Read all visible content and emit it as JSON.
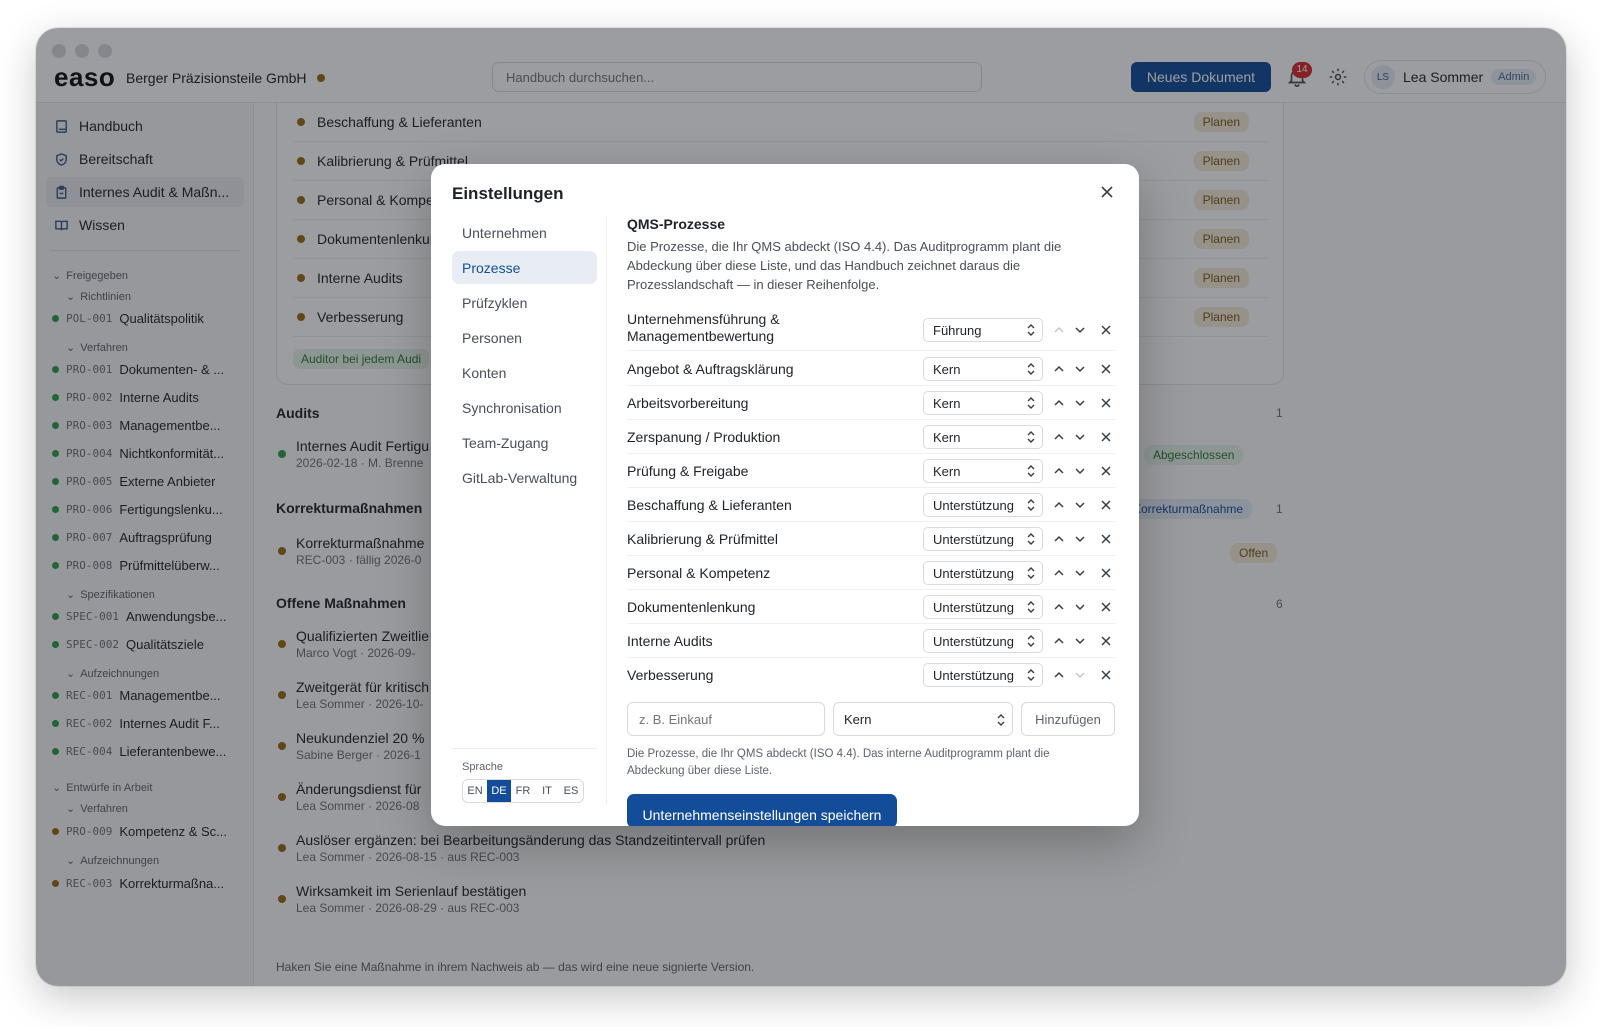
{
  "app": {
    "logo": "easo",
    "company": "Berger Präzisionsteile GmbH",
    "search_placeholder": "Handbuch durchsuchen...",
    "new_doc_label": "Neues Dokument",
    "notifications_count": "14",
    "user": {
      "initials": "LS",
      "name": "Lea Sommer",
      "role": "Admin"
    }
  },
  "sidebar": {
    "nav": [
      {
        "label": "Handbuch",
        "icon": "book-icon"
      },
      {
        "label": "Bereitschaft",
        "icon": "shield-icon"
      },
      {
        "label": "Internes Audit & Maßn...",
        "icon": "clipboard-icon"
      },
      {
        "label": "Wissen",
        "icon": "open-book-icon"
      }
    ],
    "released_label": "Freigegeben",
    "policies_label": "Richtlinien",
    "procedures_label": "Verfahren",
    "specs_label": "Spezifikationen",
    "records_label": "Aufzeichnungen",
    "drafts_label": "Entwürfe in Arbeit",
    "drafts_procedures_label": "Verfahren",
    "drafts_records_label": "Aufzeichnungen",
    "docs_policies": [
      {
        "code": "POL-001",
        "title": "Qualitätspolitik"
      }
    ],
    "docs_procedures": [
      {
        "code": "PRO-001",
        "title": "Dokumenten- & ..."
      },
      {
        "code": "PRO-002",
        "title": "Interne Audits"
      },
      {
        "code": "PRO-003",
        "title": "Managementbe..."
      },
      {
        "code": "PRO-004",
        "title": "Nichtkonformität..."
      },
      {
        "code": "PRO-005",
        "title": "Externe Anbieter"
      },
      {
        "code": "PRO-006",
        "title": "Fertigungslenku..."
      },
      {
        "code": "PRO-007",
        "title": "Auftragsprüfung"
      },
      {
        "code": "PRO-008",
        "title": "Prüfmittelüberw..."
      }
    ],
    "docs_specs": [
      {
        "code": "SPEC-001",
        "title": "Anwendungsbe..."
      },
      {
        "code": "SPEC-002",
        "title": "Qualitätsziele"
      }
    ],
    "docs_records": [
      {
        "code": "REC-001",
        "title": "Managementbe..."
      },
      {
        "code": "REC-002",
        "title": "Internes Audit F..."
      },
      {
        "code": "REC-004",
        "title": "Lieferantenbewe..."
      }
    ],
    "drafts_procedures": [
      {
        "code": "PRO-009",
        "title": "Kompetenz & Sc..."
      }
    ],
    "drafts_records": [
      {
        "code": "REC-003",
        "title": "Korrekturmaßna..."
      }
    ]
  },
  "main": {
    "plan_rows": [
      {
        "label": "Beschaffung & Lieferanten",
        "badge": "Planen"
      },
      {
        "label": "Kalibrierung & Prüfmittel",
        "badge": "Planen"
      },
      {
        "label": "Personal & Kompe",
        "badge": "Planen"
      },
      {
        "label": "Dokumentenlenkur",
        "badge": "Planen"
      },
      {
        "label": "Interne Audits",
        "badge": "Planen"
      },
      {
        "label": "Verbesserung",
        "badge": "Planen"
      }
    ],
    "auditor_tag": "Auditor bei jedem Audi",
    "audits": {
      "title": "Audits",
      "count": "1",
      "items": [
        {
          "title": "Internes Audit Fertigu",
          "meta": "2026-02-18 · M. Brenne",
          "status": "Abgeschlossen"
        }
      ]
    },
    "corrective": {
      "title": "Korrekturmaßnahmen",
      "count": "1",
      "tag": "Korrekturmaßnahme",
      "items": [
        {
          "title": "Korrekturmaßnahme",
          "meta": "REC-003 · fällig 2026-0",
          "status": "Offen"
        }
      ]
    },
    "open_actions": {
      "title": "Offene Maßnahmen",
      "count": "6",
      "items": [
        {
          "title": "Qualifizierten Zweitlie",
          "meta": "Marco Vogt · 2026-09-"
        },
        {
          "title": "Zweitgerät für kritisch",
          "meta": "Lea Sommer · 2026-10-"
        },
        {
          "title": "Neukundenziel 20 %",
          "meta": "Sabine Berger · 2026-1"
        },
        {
          "title": "Änderungsdienst für",
          "meta": "Lea Sommer · 2026-08"
        },
        {
          "title": "Auslöser ergänzen: bei Bearbeitungsänderung das Standzeitintervall prüfen",
          "meta": "Lea Sommer · 2026-08-15 · aus REC-003"
        },
        {
          "title": "Wirksamkeit im Serienlauf bestätigen",
          "meta": "Lea Sommer · 2026-08-29 · aus REC-003"
        }
      ]
    },
    "footnote": "Haken Sie eine Maßnahme in ihrem Nachweis ab — das wird eine neue signierte Version."
  },
  "modal": {
    "title": "Einstellungen",
    "nav": [
      "Unternehmen",
      "Prozesse",
      "Prüfzyklen",
      "Personen",
      "Konten",
      "Synchronisation",
      "Team-Zugang",
      "GitLab-Verwaltung"
    ],
    "active_nav": "Prozesse",
    "language_label": "Sprache",
    "languages": [
      "EN",
      "DE",
      "FR",
      "IT",
      "ES"
    ],
    "active_language": "DE",
    "section_title": "QMS-Prozesse",
    "section_desc": "Die Prozesse, die Ihr QMS abdeckt (ISO 4.4). Das Auditprogramm plant die Abdeckung über diese Liste, und das Handbuch zeichnet daraus die Prozesslandschaft — in dieser Reihenfolge.",
    "processes": [
      {
        "name": "Unternehmensführung & Managementbewertung",
        "type": "Führung"
      },
      {
        "name": "Angebot & Auftragsklärung",
        "type": "Kern"
      },
      {
        "name": "Arbeitsvorbereitung",
        "type": "Kern"
      },
      {
        "name": "Zerspanung / Produktion",
        "type": "Kern"
      },
      {
        "name": "Prüfung & Freigabe",
        "type": "Kern"
      },
      {
        "name": "Beschaffung & Lieferanten",
        "type": "Unterstützung"
      },
      {
        "name": "Kalibrierung & Prüfmittel",
        "type": "Unterstützung"
      },
      {
        "name": "Personal & Kompetenz",
        "type": "Unterstützung"
      },
      {
        "name": "Dokumentenlenkung",
        "type": "Unterstützung"
      },
      {
        "name": "Interne Audits",
        "type": "Unterstützung"
      },
      {
        "name": "Verbesserung",
        "type": "Unterstützung"
      }
    ],
    "add_placeholder": "z. B. Einkauf",
    "add_type": "Kern",
    "add_button": "Hinzufügen",
    "add_help": "Die Prozesse, die Ihr QMS abdeckt (ISO 4.4). Das interne Auditprogramm plant die Abdeckung über diese Liste.",
    "save_label": "Unternehmenseinstellungen speichern"
  },
  "colors": {
    "accent": "#134d9a",
    "released_dot": "#2f9d48",
    "draft_dot": "#9a6a16"
  }
}
